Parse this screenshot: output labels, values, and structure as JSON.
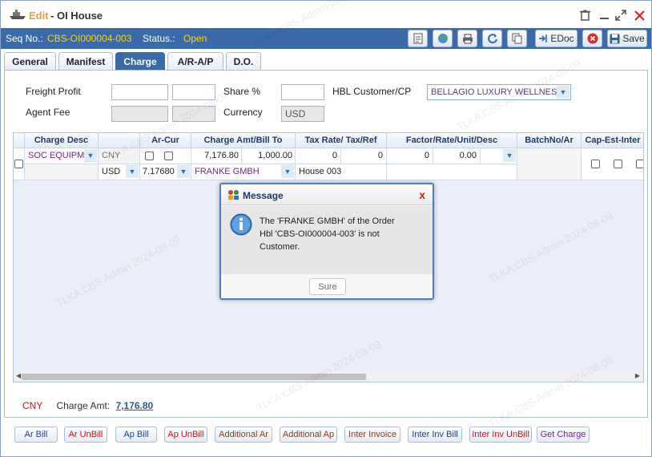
{
  "window": {
    "edit_label": "Edit",
    "separator": "-",
    "title": "OI House"
  },
  "seq": {
    "seq_label": "Seq No.:",
    "seq_value": "CBS-OI000004-003",
    "status_label": "Status.:",
    "status_value": "Open"
  },
  "toolbar": {
    "edoc_label": "EDoc",
    "save_label": "Save"
  },
  "tabs": [
    "General",
    "Manifest",
    "Charge",
    "A/R-A/P",
    "D.O."
  ],
  "form": {
    "freight_profit_label": "Freight Profit",
    "share_label": "Share %",
    "hbl_customer_label": "HBL Customer/CP",
    "hbl_customer_value": "BELLAGIO LUXURY WELLNES",
    "agent_fee_label": "Agent Fee",
    "currency_label": "Currency",
    "currency_value": "USD"
  },
  "grid": {
    "headers": [
      "Charge Desc",
      "Ar-Cur",
      "Charge Amt/Bill To",
      "Tax Rate/ Tax/Ref",
      "Factor/Rate/Unit/Desc",
      "BatchNo/Ar",
      "Cap-Est-Inter"
    ],
    "row": {
      "charge_desc": "SOC EQUIPM",
      "ar_cur": "CNY",
      "charge_amt": "7,176.80",
      "bill_amt": "1,000.00",
      "tax_rate": "0",
      "tax": "0",
      "factor": "0",
      "rate": "0.00",
      "cur2": "USD",
      "ex_rate": "7.17680",
      "bill_to": "FRANKE GMBH",
      "ref": "House 003"
    }
  },
  "summary": {
    "currency": "CNY",
    "label": "Charge Amt:",
    "value": "7,176.80"
  },
  "bottom_buttons": [
    {
      "label": "Ar Bill",
      "color": "#1c3fa6"
    },
    {
      "label": "Ar UnBill",
      "color": "#c4161c"
    },
    {
      "label": "Ap Bill",
      "color": "#1c3fa6"
    },
    {
      "label": "Ap UnBill",
      "color": "#c4161c"
    },
    {
      "label": "Additional Ar",
      "color": "#8a3b1a"
    },
    {
      "label": "Additional Ap",
      "color": "#8a3b1a"
    },
    {
      "label": "Inter Invoice",
      "color": "#8a3b1a"
    },
    {
      "label": "Inter Inv Bill",
      "color": "#1c3fa6"
    },
    {
      "label": "Inter Inv UnBill",
      "color": "#c4161c"
    },
    {
      "label": "Get Charge",
      "color": "#6b2a8a"
    }
  ],
  "dialog": {
    "title": "Message",
    "close": "x",
    "line1": "The 'FRANKE GMBH' of the Order",
    "line2": "Hbl 'CBS-OI000004-003' is not",
    "line3": "Customer.",
    "ok_label": "Sure"
  },
  "watermark": "TLKA.CBS.Admin 2024-08-09",
  "colors": {
    "accent": "#3b6aa9",
    "status": "#ffd200",
    "edit": "#e8a23a"
  },
  "icons": [
    "ship-icon",
    "trash-icon",
    "minimize-icon",
    "maximize-icon",
    "close-icon",
    "document-icon",
    "globe-icon",
    "print-icon",
    "refresh-icon",
    "copy-icon",
    "cancel-icon",
    "save-icon",
    "info-icon"
  ]
}
